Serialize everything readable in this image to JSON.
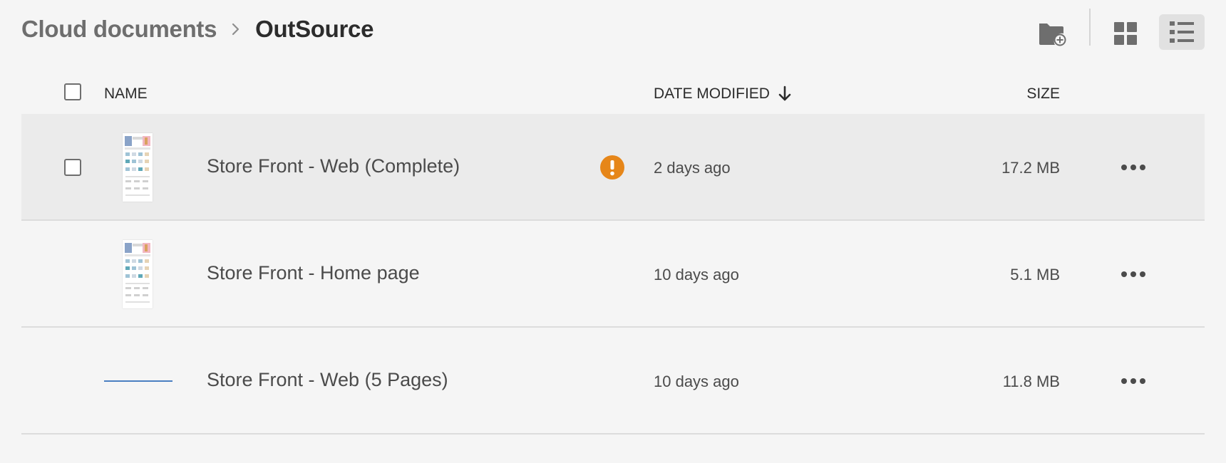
{
  "breadcrumb": {
    "parent": "Cloud documents",
    "current": "OutSource"
  },
  "toolbar": {
    "new_folder_icon": "folder-add-icon",
    "grid_view_icon": "grid-view-icon",
    "list_view_icon": "list-view-icon",
    "active_view": "list"
  },
  "table": {
    "columns": {
      "name": "NAME",
      "date_modified": "DATE MODIFIED",
      "size": "SIZE"
    },
    "sort": {
      "column": "date_modified",
      "direction": "descending"
    },
    "rows": [
      {
        "name": "Store Front - Web (Complete)",
        "date": "2 days ago",
        "size": "17.2 MB",
        "warning": true,
        "selected": true,
        "thumbnail": "page-preview"
      },
      {
        "name": "Store Front - Home page",
        "date": "10 days ago",
        "size": "5.1 MB",
        "warning": false,
        "selected": false,
        "thumbnail": "page-preview"
      },
      {
        "name": "Store Front - Web (5 Pages)",
        "date": "10 days ago",
        "size": "11.8 MB",
        "warning": false,
        "selected": false,
        "thumbnail": "line-preview"
      }
    ]
  },
  "colors": {
    "warning": "#e68619",
    "background": "#f5f5f5",
    "selected_row": "#ebebeb"
  }
}
